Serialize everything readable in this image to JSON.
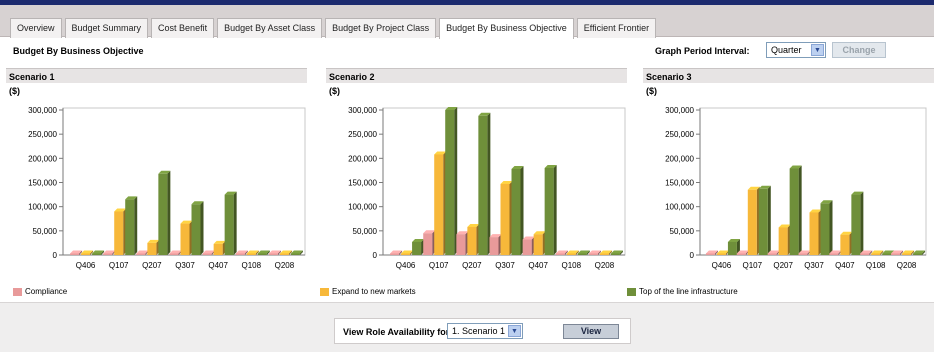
{
  "tabs": [
    {
      "label": "Overview",
      "active": false
    },
    {
      "label": "Budget Summary",
      "active": false
    },
    {
      "label": "Cost Benefit",
      "active": false
    },
    {
      "label": "Budget By Asset Class",
      "active": false
    },
    {
      "label": "Budget By Project Class",
      "active": false
    },
    {
      "label": "Budget By Business Objective",
      "active": true
    },
    {
      "label": "Efficient Frontier",
      "active": false
    }
  ],
  "page_title": "Budget By Business Objective",
  "period": {
    "label": "Graph Period Interval:",
    "selected": "Quarter",
    "change_label": "Change"
  },
  "panels": [
    {
      "title": "Scenario 1",
      "unit": "($)"
    },
    {
      "title": "Scenario 2",
      "unit": "($)"
    },
    {
      "title": "Scenario 3",
      "unit": "($)"
    }
  ],
  "colors": {
    "Compliance": "#e89a9a",
    "Expand to new markets": "#f7b83a",
    "Top of the line infrastructure": "#6f8f3a"
  },
  "chart_data": [
    {
      "type": "bar",
      "title": "Scenario 1",
      "ylabel": "($)",
      "categories": [
        "Q406",
        "Q107",
        "Q207",
        "Q307",
        "Q407",
        "Q108",
        "Q208"
      ],
      "ylim": [
        0,
        300000
      ],
      "yticks": [
        0,
        50000,
        100000,
        150000,
        200000,
        250000,
        300000
      ],
      "ytick_labels": [
        "0",
        "50,000",
        "100,000",
        "150,000",
        "200,000",
        "250,000",
        "300,000"
      ],
      "legend": "bottom",
      "grid": false,
      "series": [
        {
          "name": "Compliance",
          "values": [
            0,
            0,
            0,
            0,
            0,
            0,
            0
          ]
        },
        {
          "name": "Expand to new markets",
          "values": [
            0,
            90000,
            25000,
            65000,
            23000,
            0,
            0
          ]
        },
        {
          "name": "Top of the line infrastructure",
          "values": [
            0,
            115000,
            168000,
            105000,
            125000,
            0,
            0
          ]
        }
      ]
    },
    {
      "type": "bar",
      "title": "Scenario 2",
      "ylabel": "($)",
      "categories": [
        "Q406",
        "Q107",
        "Q207",
        "Q307",
        "Q407",
        "Q108",
        "Q208"
      ],
      "ylim": [
        0,
        300000
      ],
      "yticks": [
        0,
        50000,
        100000,
        150000,
        200000,
        250000,
        300000
      ],
      "ytick_labels": [
        "0",
        "50,000",
        "100,000",
        "150,000",
        "200,000",
        "250,000",
        "300,000"
      ],
      "legend": "bottom",
      "grid": false,
      "series": [
        {
          "name": "Compliance",
          "values": [
            0,
            45000,
            43000,
            37000,
            32000,
            0,
            0
          ]
        },
        {
          "name": "Expand to new markets",
          "values": [
            0,
            208000,
            58000,
            147000,
            43000,
            0,
            0
          ]
        },
        {
          "name": "Top of the line infrastructure",
          "values": [
            27000,
            300000,
            288000,
            178000,
            180000,
            0,
            0
          ]
        }
      ]
    },
    {
      "type": "bar",
      "title": "Scenario 3",
      "ylabel": "($)",
      "categories": [
        "Q406",
        "Q107",
        "Q207",
        "Q307",
        "Q407",
        "Q108",
        "Q208"
      ],
      "ylim": [
        0,
        300000
      ],
      "yticks": [
        0,
        50000,
        100000,
        150000,
        200000,
        250000,
        300000
      ],
      "ytick_labels": [
        "0",
        "50,000",
        "100,000",
        "150,000",
        "200,000",
        "250,000",
        "300,000"
      ],
      "legend": "bottom",
      "grid": false,
      "series": [
        {
          "name": "Compliance",
          "values": [
            0,
            0,
            0,
            0,
            0,
            0,
            0
          ]
        },
        {
          "name": "Expand to new markets",
          "values": [
            0,
            135000,
            57000,
            88000,
            42000,
            0,
            0
          ]
        },
        {
          "name": "Top of the line infrastructure",
          "values": [
            27000,
            137000,
            179000,
            107000,
            125000,
            0,
            0
          ]
        }
      ]
    }
  ],
  "legend": [
    {
      "label": "Compliance",
      "color": "#e89a9a"
    },
    {
      "label": "Expand to new markets",
      "color": "#f7b83a"
    },
    {
      "label": "Top of the line infrastructure",
      "color": "#6f8f3a"
    }
  ],
  "footer": {
    "label": "View Role Availability for:",
    "selected": "1. Scenario 1",
    "view_label": "View"
  }
}
